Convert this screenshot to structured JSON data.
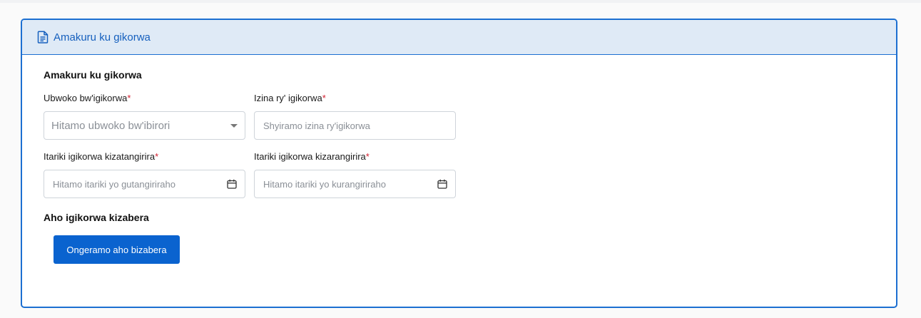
{
  "card": {
    "header_title": "Amakuru ku gikorwa",
    "header_icon": "document-icon"
  },
  "form": {
    "section_title": "Amakuru ku gikorwa",
    "type_label": "Ubwoko bw'igikorwa",
    "type_placeholder": "Hitamo ubwoko bw'ibirori",
    "name_label": "Izina ry' igikorwa",
    "name_placeholder": "Shyiramo izina ry'igikorwa",
    "start_label": "Itariki igikorwa kizatangirira",
    "start_placeholder": "Hitamo itariki yo gutangiriraho",
    "end_label": "Itariki igikorwa kizarangirira",
    "end_placeholder": "Hitamo itariki yo kurangiriraho",
    "required_mark": "*"
  },
  "location": {
    "section_title": "Aho igikorwa kizabera",
    "add_button": "Ongeramo aho bizabera"
  },
  "colors": {
    "accent": "#1c6fd1",
    "header_bg": "#dfeaf6",
    "button_bg": "#0a63cf",
    "required": "#d32030"
  }
}
